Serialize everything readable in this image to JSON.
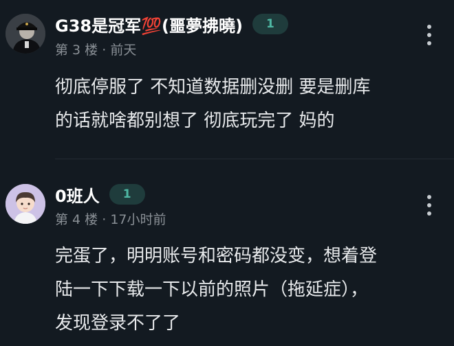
{
  "comments": [
    {
      "username": "G38是冠军💯(噩夢拂曉)",
      "likes": "1",
      "floor": "第 3 楼",
      "separator": "·",
      "time": "前天",
      "lines": [
        "彻底停服了 不知道数据删没删 要是删库",
        "的话就啥都别想了 彻底玩完了 妈的"
      ]
    },
    {
      "username": "0班人",
      "likes": "1",
      "floor": "第 4 楼",
      "separator": "·",
      "time": "17小时前",
      "lines": [
        "完蛋了，明明账号和密码都没变，想着登",
        "陆一下下载一下以前的照片（拖延症），",
        "发现登录不了了"
      ]
    }
  ],
  "colors": {
    "background": "#131a21",
    "like_badge_bg": "#1f3c3c",
    "like_badge_text": "#4fb8a4",
    "meta_text": "#8a9096"
  },
  "icons": {
    "more": "more-vertical-icon"
  }
}
